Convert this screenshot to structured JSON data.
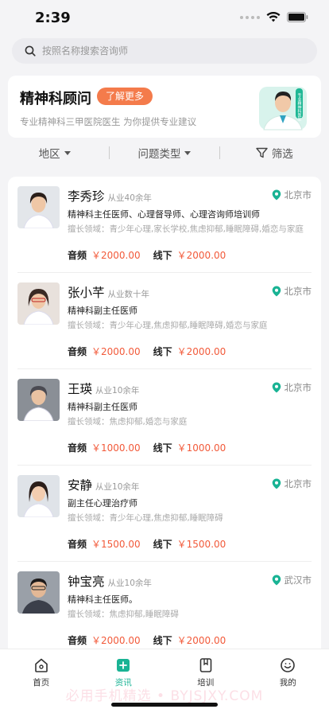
{
  "status": {
    "time": "2:39"
  },
  "search": {
    "placeholder": "按照名称搜索咨询师"
  },
  "banner": {
    "title": "精神科顾问",
    "button": "了解更多",
    "subtitle": "专业精神科三甲医院医生 为你提供专业建议",
    "image_badge": "专业精神科医生"
  },
  "filters": {
    "region": "地区",
    "type": "问题类型",
    "screen": "筛选"
  },
  "doctors": [
    {
      "name": "李秀珍",
      "experience": "从业40余年",
      "location": "北京市",
      "title": "精神科主任医师、心理督导师、心理咨询师培训师",
      "specialty": "擅长领域：青少年心理,家长学校,焦虑抑郁,睡眠障碍,婚恋与家庭",
      "audio_label": "音频",
      "audio_price": "￥2000.00",
      "offline_label": "线下",
      "offline_price": "￥2000.00"
    },
    {
      "name": "张小芊",
      "experience": "从业数十年",
      "location": "北京市",
      "title": "精神科副主任医师",
      "specialty": "擅长领域：青少年心理,焦虑抑郁,睡眠障碍,婚恋与家庭",
      "audio_label": "音频",
      "audio_price": "￥2000.00",
      "offline_label": "线下",
      "offline_price": "￥2000.00"
    },
    {
      "name": "王瑛",
      "experience": "从业10余年",
      "location": "北京市",
      "title": "精神科副主任医师",
      "specialty": "擅长领域：焦虑抑郁,婚恋与家庭",
      "audio_label": "音频",
      "audio_price": "￥1000.00",
      "offline_label": "线下",
      "offline_price": "￥1000.00"
    },
    {
      "name": "安静",
      "experience": "从业10余年",
      "location": "北京市",
      "title": "副主任心理治疗师",
      "specialty": "擅长领域：青少年心理,焦虑抑郁,睡眠障碍",
      "audio_label": "音频",
      "audio_price": "￥1500.00",
      "offline_label": "线下",
      "offline_price": "￥1500.00"
    },
    {
      "name": "钟宝亮",
      "experience": "从业10余年",
      "location": "武汉市",
      "title": "精神科主任医师。",
      "specialty": "擅长领域：焦虑抑郁,睡眠障碍",
      "audio_label": "音频",
      "audio_price": "￥2000.00",
      "offline_label": "线下",
      "offline_price": "￥2000.00"
    }
  ],
  "tabs": [
    {
      "label": "首页",
      "icon": "home-icon"
    },
    {
      "label": "资讯",
      "icon": "news-icon"
    },
    {
      "label": "培训",
      "icon": "training-icon"
    },
    {
      "label": "我的",
      "icon": "profile-icon"
    }
  ],
  "watermark": "必用手机精选 • BYJSJXY.COM",
  "colors": {
    "accent": "#19b394",
    "price": "#f25a3a",
    "button": "#f47b4b"
  }
}
